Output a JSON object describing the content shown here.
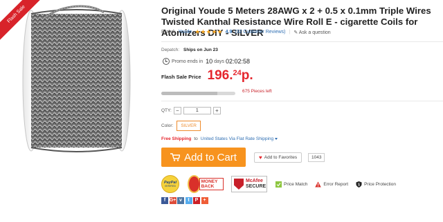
{
  "ribbon": {
    "label": "Flash Sale"
  },
  "product": {
    "title": "Original Youde 5 Meters 28AWG x 2 + 0.5 x 0.1mm Triple Wires Twisted Kanthal Resistance Wire Roll E - cigarette Coils for Atomizers DIY  -  SILVER",
    "brand_label": "Brand:",
    "brand": "Youde",
    "rating": "4.9",
    "reviews": "(32 Customer Reviews)",
    "separator": "|",
    "ask": "Ask a question"
  },
  "dispatch": {
    "label": "Depatch:",
    "value": "Ships on Jun 23"
  },
  "promo": {
    "label": "Promo ends in",
    "days": "10",
    "days_label": "days",
    "time": "02:02:58"
  },
  "price": {
    "label": "Flash Sale Price",
    "integer": "196.",
    "decimal": "24",
    "currency": "p."
  },
  "stock": {
    "text": "675 Pieces left",
    "progress": 0.76
  },
  "quantity": {
    "label": "QTY:",
    "minus": "−",
    "value": "1",
    "plus": "+"
  },
  "color": {
    "label": "Color:",
    "selected": "SILVER"
  },
  "shipping": {
    "free": "Free Shipping",
    "to": "to",
    "method": "United States Via Flat Rate Shipping"
  },
  "actions": {
    "add_to_cart": "Add to Cart",
    "favorites": "Add to Favorites",
    "favorites_count": "1043"
  },
  "badges": {
    "paypal": {
      "name": "PayPal",
      "sub": "VERIFIED"
    },
    "money_back": "MONEY BACK",
    "mcafee": {
      "brand": "McAfee",
      "secure": "SECURE"
    },
    "price_match": "Price Match",
    "error_report": "Error Report",
    "price_protection": "Price Protection"
  },
  "social": {
    "facebook": {
      "glyph": "f",
      "color": "#3b5998"
    },
    "google": {
      "glyph": "G+",
      "color": "#dd4b39"
    },
    "vk": {
      "glyph": "v",
      "color": "#4c75a3"
    },
    "twitter": {
      "glyph": "t",
      "color": "#55acee"
    },
    "pinterest": {
      "glyph": "P",
      "color": "#cb2027"
    },
    "more": {
      "glyph": "+",
      "color": "#ef5d37"
    }
  },
  "colors": {
    "accent_orange": "#f7931e",
    "price_red": "#e5262d",
    "link_blue": "#2f6fb3"
  }
}
